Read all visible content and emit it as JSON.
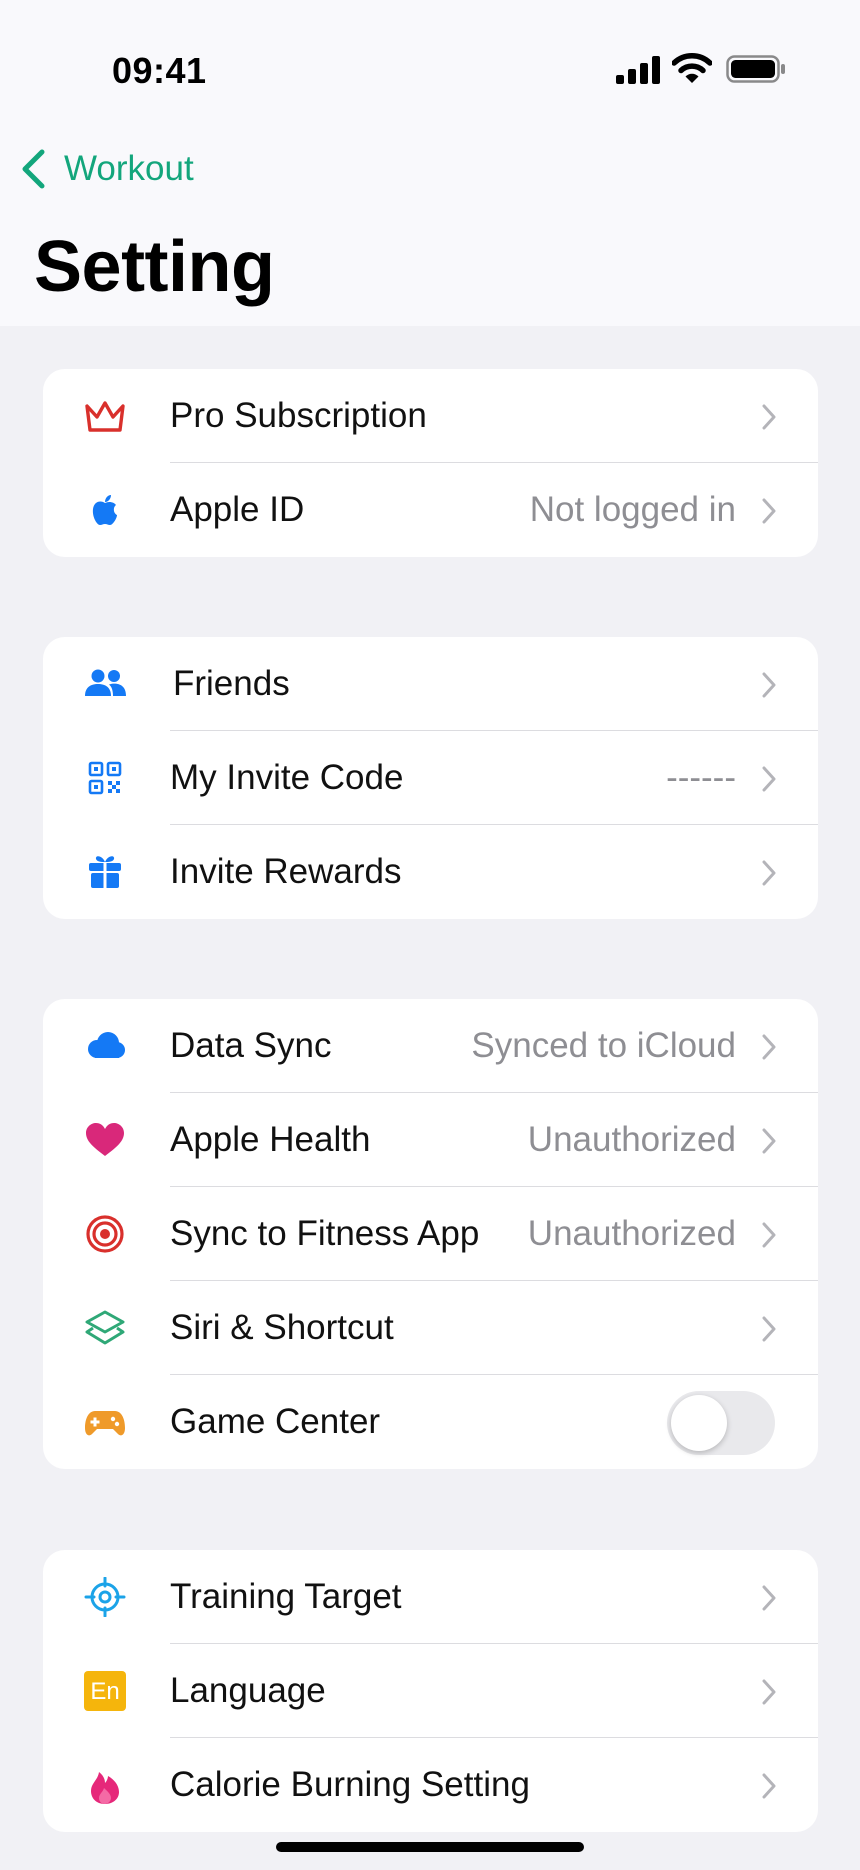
{
  "status_bar": {
    "time": "09:41"
  },
  "nav": {
    "back_label": "Workout",
    "title": "Setting"
  },
  "colors": {
    "accent": "#13a67c",
    "secondary_text": "#8e8e93"
  },
  "groups": [
    {
      "rows": [
        {
          "icon": "crown-icon",
          "label": "Pro Subscription",
          "value": ""
        },
        {
          "icon": "apple-logo-icon",
          "label": "Apple ID",
          "value": "Not logged in"
        }
      ]
    },
    {
      "rows": [
        {
          "icon": "people-icon",
          "label": "Friends",
          "value": ""
        },
        {
          "icon": "qr-code-icon",
          "label": "My Invite Code",
          "value": "------"
        },
        {
          "icon": "gift-icon",
          "label": "Invite Rewards",
          "value": ""
        }
      ]
    },
    {
      "rows": [
        {
          "icon": "cloud-icon",
          "label": "Data Sync",
          "value": "Synced to iCloud"
        },
        {
          "icon": "heart-icon",
          "label": "Apple Health",
          "value": "Unauthorized"
        },
        {
          "icon": "target-icon",
          "label": "Sync to Fitness App",
          "value": "Unauthorized"
        },
        {
          "icon": "shortcuts-icon",
          "label": "Siri & Shortcut",
          "value": ""
        },
        {
          "icon": "gamepad-icon",
          "label": "Game Center",
          "toggle_on": false
        }
      ]
    },
    {
      "rows": [
        {
          "icon": "crosshair-icon",
          "label": "Training Target",
          "value": ""
        },
        {
          "icon": "language-icon",
          "label": "Language",
          "value": "",
          "icon_text": "En"
        },
        {
          "icon": "flame-icon",
          "label": "Calorie Burning Setting",
          "value": ""
        }
      ]
    }
  ]
}
